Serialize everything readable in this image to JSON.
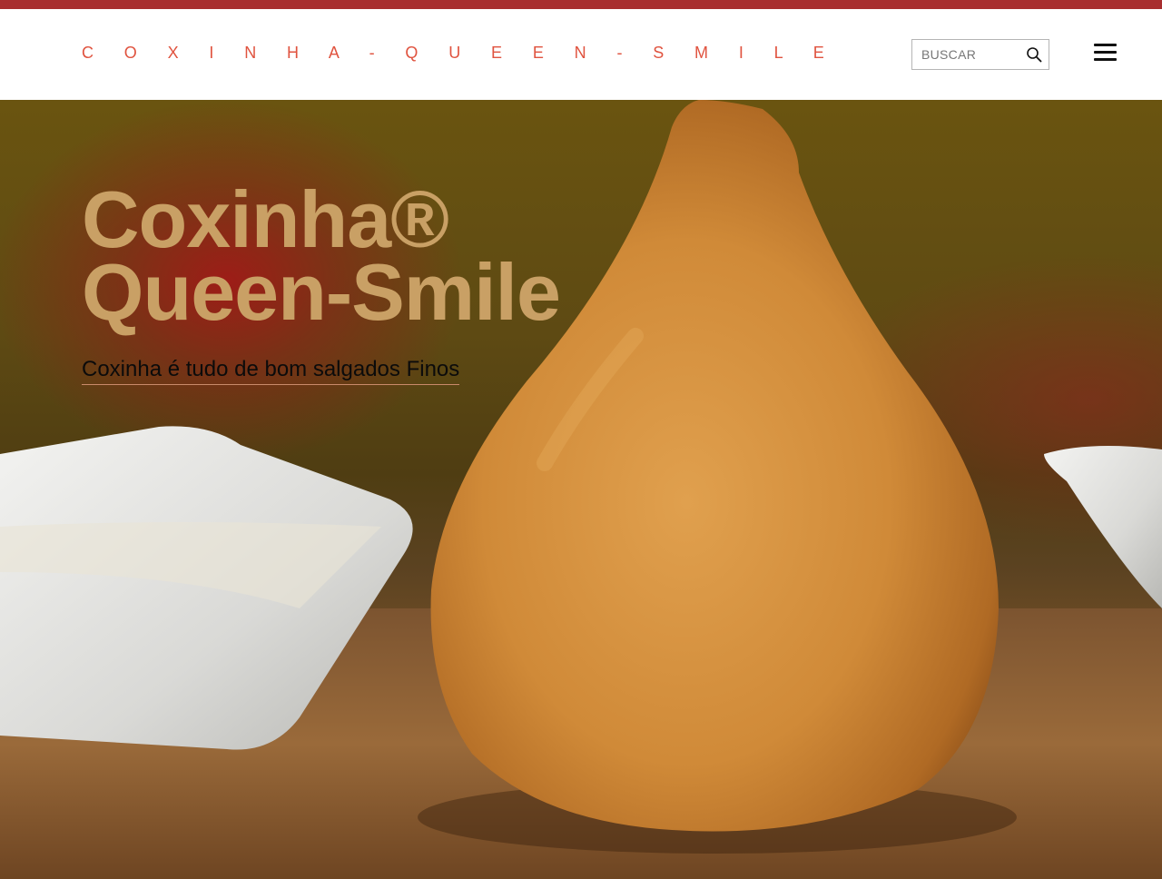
{
  "header": {
    "brand": "C O X I N H A - Q U E E N - S M I L E",
    "search": {
      "placeholder": "BUSCAR",
      "value": ""
    },
    "search_icon": "search-icon",
    "menu_icon": "hamburger-menu-icon"
  },
  "hero": {
    "title_line1": "Coxinha®",
    "title_line2": "Queen-Smile",
    "subtitle": "Coxinha é tudo de bom salgados Finos",
    "image": "coxinha-photo"
  },
  "colors": {
    "top_strip": "#a82e2f",
    "brand": "#e0533f",
    "title": "#c9a065"
  }
}
